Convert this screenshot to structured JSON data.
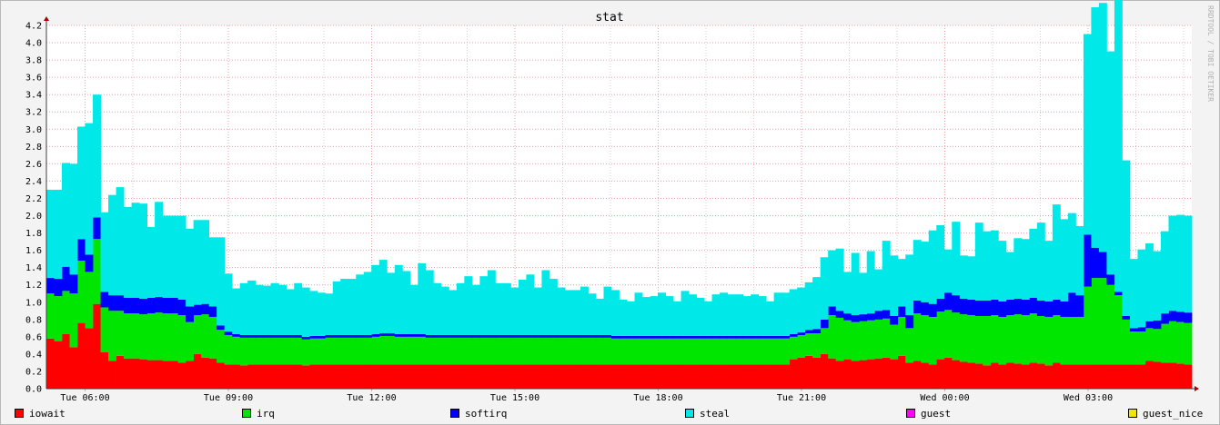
{
  "chart_data": {
    "type": "area",
    "stacked": true,
    "title": "stat",
    "watermark": "RRDTOOL / TOBI OETIKER",
    "ylim": [
      0,
      4.2
    ],
    "yticks": [
      "0.0",
      "0.2",
      "0.4",
      "0.6",
      "0.8",
      "1.0",
      "1.2",
      "1.4",
      "1.6",
      "1.8",
      "2.0",
      "2.2",
      "2.4",
      "2.6",
      "2.8",
      "3.0",
      "3.2",
      "3.4",
      "3.6",
      "3.8",
      "4.0",
      "4.2"
    ],
    "xticks": [
      "Tue 06:00",
      "Tue 09:00",
      "Tue 12:00",
      "Tue 15:00",
      "Tue 18:00",
      "Tue 21:00",
      "Wed 00:00",
      "Wed 03:00"
    ],
    "grid": true,
    "legend_position": "bottom",
    "series": [
      {
        "name": "iowait",
        "color": "#ff0000",
        "values": [
          0.58,
          0.55,
          0.63,
          0.48,
          0.76,
          0.7,
          0.98,
          0.42,
          0.32,
          0.38,
          0.35,
          0.35,
          0.34,
          0.33,
          0.33,
          0.32,
          0.32,
          0.3,
          0.32,
          0.4,
          0.36,
          0.35,
          0.3,
          0.28,
          0.28,
          0.27,
          0.28,
          0.28,
          0.28,
          0.28,
          0.28,
          0.28,
          0.28,
          0.27,
          0.28,
          0.28,
          0.28,
          0.28,
          0.28,
          0.28,
          0.28,
          0.28,
          0.28,
          0.28,
          0.28,
          0.28,
          0.28,
          0.28,
          0.28,
          0.28,
          0.28,
          0.28,
          0.28,
          0.28,
          0.28,
          0.28,
          0.28,
          0.28,
          0.28,
          0.28,
          0.28,
          0.28,
          0.28,
          0.28,
          0.28,
          0.28,
          0.28,
          0.28,
          0.28,
          0.28,
          0.28,
          0.28,
          0.28,
          0.28,
          0.28,
          0.28,
          0.28,
          0.28,
          0.28,
          0.28,
          0.28,
          0.28,
          0.28,
          0.28,
          0.28,
          0.28,
          0.28,
          0.28,
          0.28,
          0.28,
          0.28,
          0.28,
          0.28,
          0.28,
          0.28,
          0.28,
          0.34,
          0.36,
          0.38,
          0.36,
          0.4,
          0.35,
          0.32,
          0.34,
          0.32,
          0.33,
          0.34,
          0.35,
          0.36,
          0.34,
          0.38,
          0.3,
          0.32,
          0.3,
          0.28,
          0.34,
          0.36,
          0.33,
          0.31,
          0.3,
          0.29,
          0.27,
          0.3,
          0.28,
          0.3,
          0.29,
          0.28,
          0.3,
          0.29,
          0.27,
          0.3,
          0.28,
          0.28,
          0.28,
          0.28,
          0.28,
          0.28,
          0.28,
          0.28,
          0.28,
          0.28,
          0.28,
          0.32,
          0.31,
          0.3,
          0.3,
          0.29,
          0.28
        ]
      },
      {
        "name": "irq",
        "color": "#00e600",
        "values": [
          0.52,
          0.52,
          0.5,
          0.62,
          0.72,
          0.65,
          0.75,
          0.52,
          0.58,
          0.52,
          0.52,
          0.52,
          0.52,
          0.54,
          0.55,
          0.55,
          0.55,
          0.55,
          0.45,
          0.45,
          0.5,
          0.48,
          0.38,
          0.34,
          0.32,
          0.32,
          0.31,
          0.31,
          0.31,
          0.31,
          0.31,
          0.31,
          0.31,
          0.3,
          0.3,
          0.3,
          0.31,
          0.31,
          0.31,
          0.31,
          0.31,
          0.31,
          0.32,
          0.33,
          0.33,
          0.32,
          0.32,
          0.32,
          0.32,
          0.31,
          0.31,
          0.31,
          0.31,
          0.31,
          0.31,
          0.31,
          0.31,
          0.31,
          0.31,
          0.31,
          0.31,
          0.31,
          0.31,
          0.31,
          0.31,
          0.31,
          0.31,
          0.31,
          0.31,
          0.31,
          0.31,
          0.31,
          0.31,
          0.3,
          0.3,
          0.3,
          0.3,
          0.3,
          0.3,
          0.3,
          0.3,
          0.3,
          0.3,
          0.3,
          0.3,
          0.3,
          0.3,
          0.3,
          0.3,
          0.3,
          0.3,
          0.3,
          0.3,
          0.3,
          0.3,
          0.3,
          0.26,
          0.26,
          0.26,
          0.28,
          0.3,
          0.5,
          0.5,
          0.45,
          0.45,
          0.45,
          0.45,
          0.45,
          0.45,
          0.4,
          0.45,
          0.4,
          0.55,
          0.55,
          0.55,
          0.55,
          0.55,
          0.55,
          0.55,
          0.55,
          0.55,
          0.57,
          0.55,
          0.55,
          0.55,
          0.57,
          0.57,
          0.57,
          0.55,
          0.56,
          0.55,
          0.55,
          0.55,
          0.55,
          0.9,
          1.0,
          1.0,
          0.92,
          0.8,
          0.52,
          0.38,
          0.38,
          0.38,
          0.38,
          0.45,
          0.48,
          0.48,
          0.48,
          0.48,
          0.47
        ]
      },
      {
        "name": "softirq",
        "color": "#0000ff",
        "values": [
          0.18,
          0.2,
          0.28,
          0.22,
          0.25,
          0.2,
          0.25,
          0.18,
          0.18,
          0.18,
          0.18,
          0.18,
          0.18,
          0.18,
          0.18,
          0.18,
          0.18,
          0.18,
          0.18,
          0.12,
          0.12,
          0.12,
          0.05,
          0.04,
          0.03,
          0.03,
          0.03,
          0.03,
          0.03,
          0.03,
          0.03,
          0.03,
          0.03,
          0.03,
          0.03,
          0.03,
          0.03,
          0.03,
          0.03,
          0.03,
          0.03,
          0.03,
          0.03,
          0.03,
          0.03,
          0.03,
          0.03,
          0.03,
          0.03,
          0.03,
          0.03,
          0.03,
          0.03,
          0.03,
          0.03,
          0.03,
          0.03,
          0.03,
          0.03,
          0.03,
          0.03,
          0.03,
          0.03,
          0.03,
          0.03,
          0.03,
          0.03,
          0.03,
          0.03,
          0.03,
          0.03,
          0.03,
          0.03,
          0.03,
          0.03,
          0.03,
          0.03,
          0.03,
          0.03,
          0.03,
          0.03,
          0.03,
          0.03,
          0.03,
          0.03,
          0.03,
          0.03,
          0.03,
          0.03,
          0.03,
          0.03,
          0.03,
          0.03,
          0.03,
          0.03,
          0.03,
          0.03,
          0.03,
          0.04,
          0.05,
          0.1,
          0.1,
          0.08,
          0.08,
          0.08,
          0.08,
          0.08,
          0.1,
          0.1,
          0.1,
          0.12,
          0.15,
          0.15,
          0.15,
          0.15,
          0.15,
          0.2,
          0.2,
          0.18,
          0.18,
          0.18,
          0.18,
          0.18,
          0.18,
          0.18,
          0.18,
          0.18,
          0.18,
          0.18,
          0.18,
          0.18,
          0.18,
          0.28,
          0.25,
          0.6,
          0.35,
          0.3,
          0.12,
          0.04,
          0.04,
          0.04,
          0.05,
          0.08,
          0.1,
          0.12,
          0.12,
          0.12,
          0.12
        ]
      },
      {
        "name": "steal",
        "color": "#00e8e8",
        "values": [
          1.02,
          1.03,
          1.2,
          1.28,
          1.3,
          1.52,
          1.42,
          0.92,
          1.16,
          1.25,
          1.05,
          1.1,
          1.1,
          0.82,
          1.1,
          0.95,
          0.95,
          0.97,
          0.9,
          0.98,
          0.97,
          0.8,
          1.02,
          0.67,
          0.53,
          0.6,
          0.63,
          0.58,
          0.57,
          0.6,
          0.58,
          0.53,
          0.6,
          0.57,
          0.52,
          0.5,
          0.48,
          0.62,
          0.65,
          0.65,
          0.7,
          0.73,
          0.8,
          0.85,
          0.7,
          0.8,
          0.73,
          0.57,
          0.82,
          0.75,
          0.6,
          0.56,
          0.52,
          0.6,
          0.68,
          0.58,
          0.68,
          0.75,
          0.6,
          0.6,
          0.55,
          0.64,
          0.7,
          0.55,
          0.75,
          0.65,
          0.55,
          0.52,
          0.52,
          0.56,
          0.48,
          0.42,
          0.56,
          0.53,
          0.42,
          0.4,
          0.5,
          0.45,
          0.46,
          0.5,
          0.46,
          0.4,
          0.52,
          0.48,
          0.44,
          0.4,
          0.48,
          0.5,
          0.48,
          0.48,
          0.46,
          0.48,
          0.46,
          0.4,
          0.5,
          0.5,
          0.52,
          0.52,
          0.55,
          0.6,
          0.72,
          0.65,
          0.72,
          0.48,
          0.72,
          0.48,
          0.72,
          0.48,
          0.8,
          0.7,
          0.55,
          0.7,
          0.7,
          0.7,
          0.85,
          0.85,
          0.5,
          0.85,
          0.5,
          0.5,
          0.9,
          0.8,
          0.8,
          0.7,
          0.55,
          0.7,
          0.7,
          0.8,
          0.9,
          0.7,
          1.1,
          0.95,
          0.92,
          0.8,
          2.32,
          2.78,
          2.88,
          2.58,
          3.42,
          1.8,
          0.8,
          0.9,
          0.9,
          0.8,
          0.95,
          1.1,
          1.12,
          1.12,
          1.02,
          0.94
        ]
      },
      {
        "name": "guest",
        "color": "#ff00ff",
        "values": []
      },
      {
        "name": "guest_nice",
        "color": "#f2e600",
        "values": []
      }
    ]
  }
}
